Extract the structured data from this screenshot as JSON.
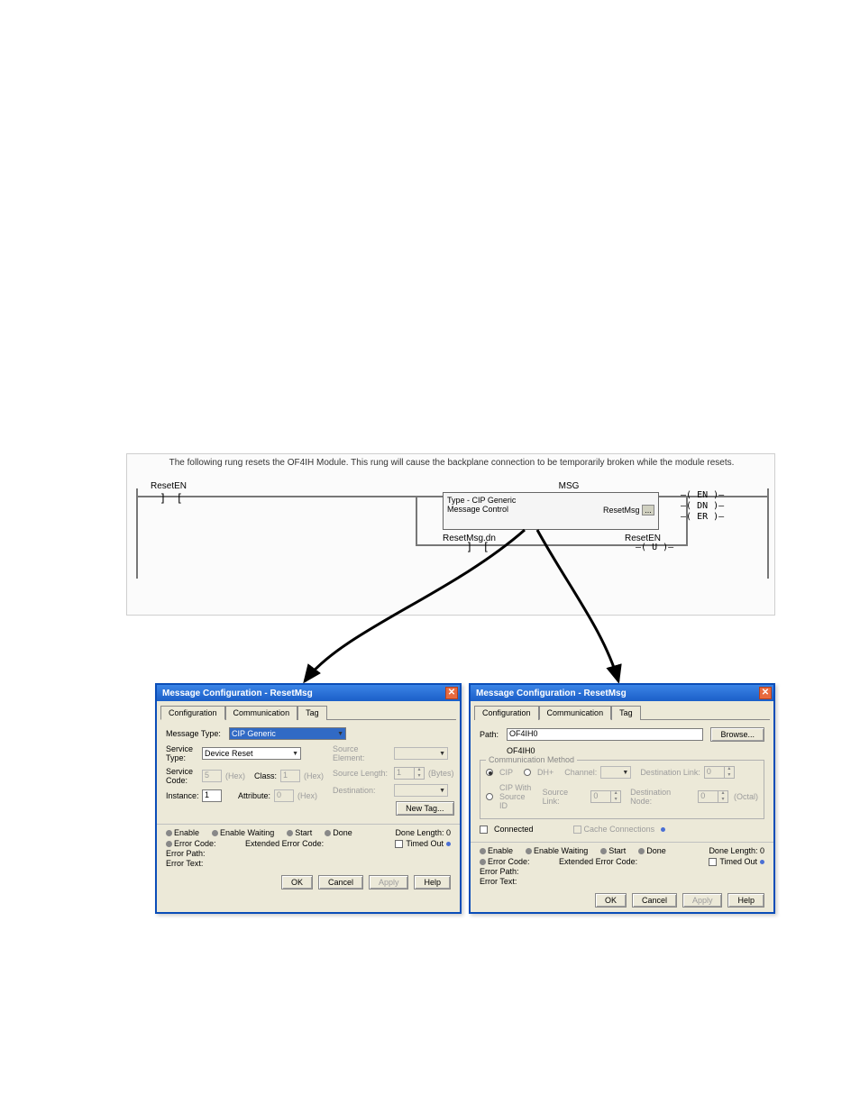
{
  "rung": {
    "comment": "The following rung resets the OF4IH Module.  This rung will cause the backplane connection to be temporarily broken while the module resets.",
    "xic_label": "ResetEN",
    "msg_header": "MSG",
    "msg_line1": "Type - CIP Generic",
    "msg_line2": "Message Control",
    "msg_tag": "ResetMsg",
    "coil_en": "EN",
    "coil_dn": "DN",
    "coil_er": "ER",
    "branch_xic": "ResetMsg.dn",
    "branch_coil_label": "ResetEN",
    "branch_coil_sym": "U"
  },
  "dlg1": {
    "title": "Message Configuration - ResetMsg",
    "tabs": {
      "config": "Configuration",
      "comm": "Communication",
      "tag": "Tag"
    },
    "message_type_lbl": "Message Type:",
    "message_type_val": "CIP Generic",
    "service_type_lbl": "Service\nType:",
    "service_type_val": "Device Reset",
    "service_code_lbl": "Service\nCode:",
    "service_code_val": "5",
    "hex": "(Hex)",
    "class_lbl": "Class:",
    "class_val": "1",
    "instance_lbl": "Instance:",
    "instance_val": "1",
    "attribute_lbl": "Attribute:",
    "attribute_val": "0",
    "source_elem_lbl": "Source Element:",
    "source_len_lbl": "Source Length:",
    "source_len_val": "1",
    "bytes": "(Bytes)",
    "dest_lbl": "Destination:",
    "new_tag_btn": "New Tag...",
    "status": {
      "enable": "Enable",
      "enable_wait": "Enable Waiting",
      "start": "Start",
      "done": "Done",
      "done_len": "Done Length: 0"
    },
    "error_code": "Error Code:",
    "ext_error": "Extended Error Code:",
    "error_path": "Error Path:",
    "error_text": "Error Text:",
    "timed_out": "Timed Out",
    "btns": {
      "ok": "OK",
      "cancel": "Cancel",
      "apply": "Apply",
      "help": "Help"
    }
  },
  "dlg2": {
    "title": "Message Configuration - ResetMsg",
    "tabs": {
      "config": "Configuration",
      "comm": "Communication",
      "tag": "Tag"
    },
    "path_lbl": "Path:",
    "path_val": "OF4IH0",
    "path_echo": "OF4IH0",
    "browse": "Browse...",
    "comm_method_title": "Communication Method",
    "cip": "CIP",
    "dhplus": "DH+",
    "channel_lbl": "Channel:",
    "dest_link_lbl": "Destination Link:",
    "dest_link_val": "0",
    "cip_src": "CIP With\nSource ID",
    "src_link_lbl": "Source Link:",
    "src_link_val": "0",
    "dest_node_lbl": "Destination Node:",
    "dest_node_val": "0",
    "octal": "(Octal)",
    "connected": "Connected",
    "cache": "Cache Connections",
    "status": {
      "enable": "Enable",
      "enable_wait": "Enable Waiting",
      "start": "Start",
      "done": "Done",
      "done_len": "Done Length: 0"
    },
    "error_code": "Error Code:",
    "ext_error": "Extended Error Code:",
    "error_path": "Error Path:",
    "error_text": "Error Text:",
    "timed_out": "Timed Out",
    "btns": {
      "ok": "OK",
      "cancel": "Cancel",
      "apply": "Apply",
      "help": "Help"
    }
  }
}
